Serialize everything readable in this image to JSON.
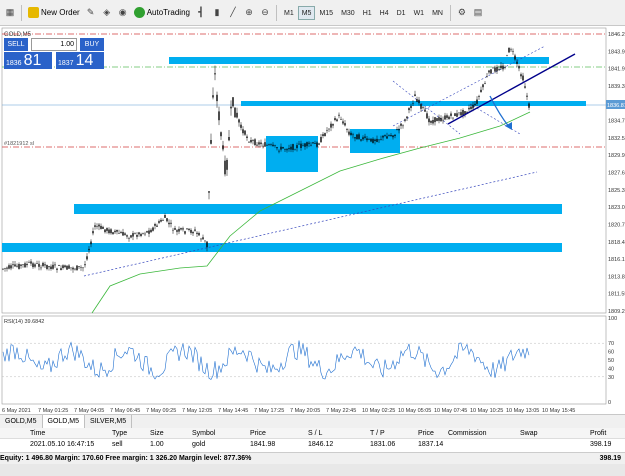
{
  "toolbar": {
    "new_order_label": "New Order",
    "autotrading_label": "AutoTrading",
    "timeframes": [
      "M1",
      "M5",
      "M15",
      "M30",
      "H1",
      "H4",
      "D1",
      "W1",
      "MN"
    ],
    "active_timeframe": "M5"
  },
  "chart": {
    "symbol_header": "GOLD,M5",
    "indicator_label": "RSI(14) 39.6842",
    "price_axis": [
      "1846.20",
      "1843.90",
      "1841.95",
      "1839.35",
      "1836.81",
      "1834.75",
      "1832.50",
      "1829.95",
      "1827.65",
      "1825.35",
      "1823.05",
      "1820.75",
      "1818.45",
      "1816.15",
      "1813.85",
      "1811.55",
      "1809.20"
    ],
    "current_price": "1836.81",
    "level_label": "#1821912 sl",
    "rsi_axis": [
      "100",
      "70",
      "60",
      "50",
      "40",
      "30",
      "0"
    ],
    "time_axis": [
      "6 May 2021",
      "7 May 01:25",
      "7 May 04:05",
      "7 May 06:45",
      "7 May 09:25",
      "7 May 12:05",
      "7 May 14:45",
      "7 May 17:25",
      "7 May 20:05",
      "7 May 22:45",
      "10 May 02:25",
      "10 May 05:05",
      "10 May 07:45",
      "10 May 10:25",
      "10 May 13:05",
      "10 May 15:45"
    ]
  },
  "trade_panel": {
    "sell_label": "SELL",
    "buy_label": "BUY",
    "lot": "1.00",
    "sell_small": "1836",
    "sell_big": "81",
    "buy_small": "1837",
    "buy_big": "14"
  },
  "tabs": [
    "GOLD,M5",
    "GOLD,M5",
    "SILVER,M5"
  ],
  "active_tab": 1,
  "terminal": {
    "headers": [
      "Time",
      "Type",
      "Size",
      "Symbol",
      "Price",
      "S / L",
      "T / P",
      "Price",
      "Commission",
      "Swap",
      "Profit"
    ],
    "row": [
      "2021.05.10 16:47:15",
      "sell",
      "1.00",
      "gold",
      "1841.98",
      "1846.12",
      "1831.06",
      "1837.14",
      "",
      "",
      "398.19"
    ]
  },
  "status": {
    "summary": "Equity: 1 496.80  Margin: 170.60  Free margin: 1 326.20  Margin level: 877.36%",
    "total_profit": "398.19"
  },
  "colors": {
    "zone_fill": "#00aef0",
    "rsi_line": "#1f6fd0",
    "ma_line": "#3cb83c",
    "candles": "#000000",
    "trend_line": "#00008b",
    "level_red": "#d23c3c",
    "level_green": "#5cbf5c"
  }
}
